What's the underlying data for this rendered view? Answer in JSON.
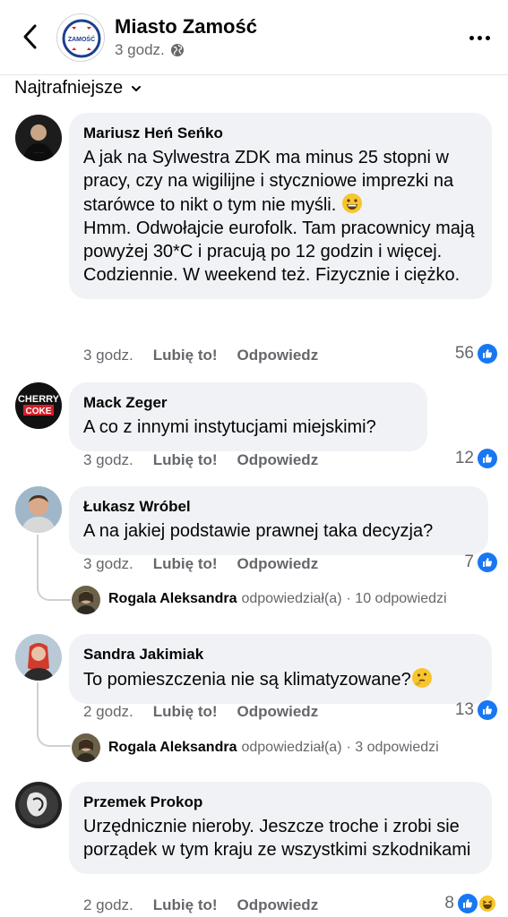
{
  "header": {
    "page_name": "Miasto Zamość",
    "time": "3 godz.",
    "logo_text": "ZAMOŚĆ",
    "back_icon": "chevron-left-icon",
    "privacy_icon": "globe-icon",
    "more_icon": "more-horizontal-icon"
  },
  "sort": {
    "label": "Najtrafniejsze",
    "icon": "chevron-down-icon"
  },
  "actions": {
    "like": "Lubię to!",
    "reply": "Odpowiedz"
  },
  "comments": [
    {
      "author": "Mariusz Heń Seńko",
      "text_1": "A jak na Sylwestra ZDK ma minus 25 stopni w pracy, czy na wigilijne i styczniowe imprezki na starówce to nikt o tym nie myśli.",
      "text_2": "Hmm. Odwołajcie eurofolk. Tam pracownicy mają powyżej 30*C i pracują po 12 godzin i więcej. Codziennie. W weekend też. Fizycznie i ciężko.",
      "time": "3 godz.",
      "reactions": "56",
      "reaction_icons": [
        "like"
      ]
    },
    {
      "author": "Mack Zeger",
      "text": "A co z innymi instytucjami miejskimi?",
      "time": "3 godz.",
      "reactions": "12",
      "reaction_icons": [
        "like"
      ]
    },
    {
      "author": "Łukasz Wróbel",
      "text": "A na jakiej podstawie prawnej taka decyzja?",
      "time": "3 godz.",
      "reactions": "7",
      "reaction_icons": [
        "like"
      ],
      "reply_summary": {
        "author": "Rogala Aleksandra",
        "verb": "odpowiedział(a)",
        "count": "· 10 odpowiedzi"
      }
    },
    {
      "author": "Sandra Jakimiak",
      "text": "To pomieszczenia nie są klimatyzowane?",
      "time": "2 godz.",
      "reactions": "13",
      "reaction_icons": [
        "like"
      ],
      "reply_summary": {
        "author": "Rogala Aleksandra",
        "verb": "odpowiedział(a)",
        "count": "· 3 odpowiedzi"
      }
    },
    {
      "author": "Przemek Prokop",
      "text": "Urzędnicznie nieroby. Jeszcze troche i zrobi sie porządek w tym kraju ze wszystkimi szkodnikami",
      "time": "2 godz.",
      "reactions": "8",
      "reaction_icons": [
        "like",
        "haha"
      ]
    }
  ],
  "colors": {
    "like_blue": "#1877f2",
    "bubble_bg": "#f0f2f5",
    "muted": "#65676b"
  }
}
